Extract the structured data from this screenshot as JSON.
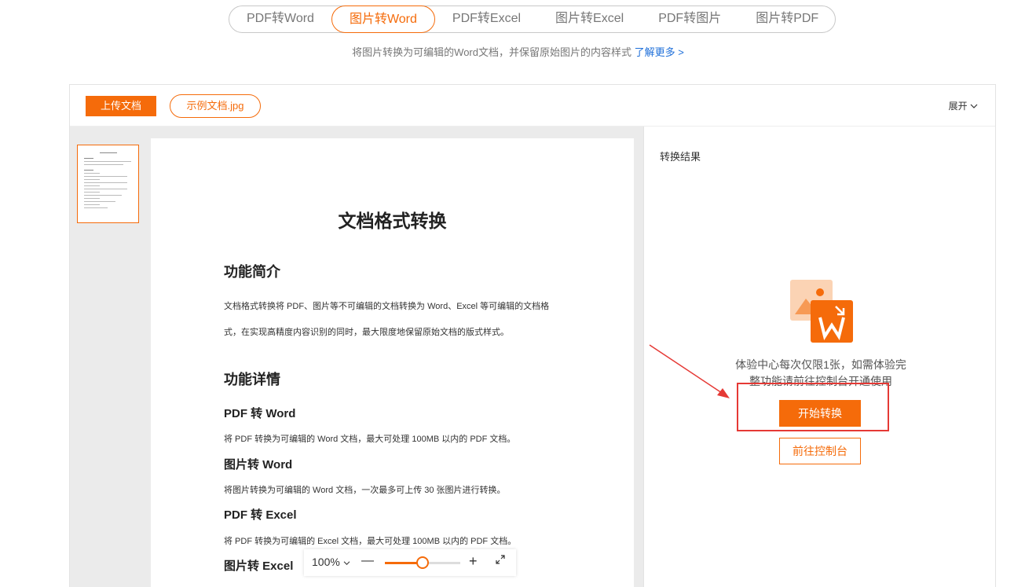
{
  "tabs": [
    {
      "label": "PDF转Word"
    },
    {
      "label": "图片转Word"
    },
    {
      "label": "PDF转Excel"
    },
    {
      "label": "图片转Excel"
    },
    {
      "label": "PDF转图片"
    },
    {
      "label": "图片转PDF"
    }
  ],
  "subtitle": {
    "text": "将图片转换为可编辑的Word文档，并保留原始图片的内容样式 ",
    "link": "了解更多 >"
  },
  "toolbar": {
    "upload": "上传文档",
    "sample": "示例文档.jpg",
    "expand": "展开"
  },
  "document": {
    "title": "文档格式转换",
    "intro_heading": "功能简介",
    "intro_line1": "文档格式转换将 PDF、图片等不可编辑的文档转换为 Word、Excel 等可编辑的文档格",
    "intro_line2": "式，在实现高精度内容识别的同时，最大限度地保留原始文档的版式样式。",
    "details_heading": "功能详情",
    "s1_title": "PDF 转 Word",
    "s1_text": "将 PDF 转换为可编辑的 Word 文档，最大可处理 100MB 以内的 PDF 文档。",
    "s2_title": "图片转 Word",
    "s2_text": "将图片转换为可编辑的 Word 文档，一次最多可上传 30 张图片进行转换。",
    "s3_title": "PDF 转 Excel",
    "s3_text": "将 PDF 转换为可编辑的 Excel 文档，最大可处理 100MB 以内的 PDF 文档。",
    "s4_title": "图片转 Excel"
  },
  "zoom": {
    "value": "100%",
    "minus": "—",
    "plus": "+",
    "level": 0.5
  },
  "result": {
    "label": "转换结果",
    "limit_line1": "体验中心每次仅限1张，如需体验完",
    "limit_line2": "整功能请前往控制台开通使用",
    "start": "开始转换",
    "console": "前往控制台"
  },
  "colors": {
    "accent": "#f56b0a",
    "highlight": "#e53935"
  }
}
